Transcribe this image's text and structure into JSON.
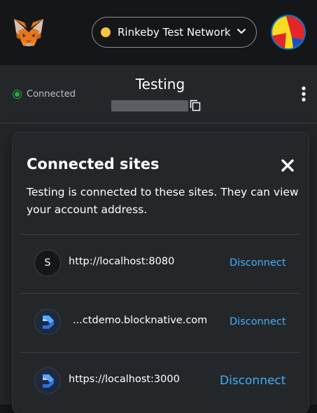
{
  "header": {
    "network": {
      "label": "Rinkeby Test Network",
      "dot_color": "#f6c343"
    }
  },
  "account": {
    "status": "Connected",
    "name": "Testing"
  },
  "modal": {
    "title": "Connected sites",
    "description": "Testing is connected to these sites. They can view your account address.",
    "disconnect_label": "Disconnect",
    "sites": [
      {
        "icon_letter": "S",
        "url": "http://localhost:8080",
        "icon": "letter"
      },
      {
        "url": "...ctdemo.blocknative.com",
        "icon": "blocknative-logo-icon"
      },
      {
        "url": "https://localhost:3000",
        "icon": "blocknative-logo-icon"
      }
    ]
  },
  "colors": {
    "accent_link": "#43aefc",
    "connected_green": "#28a745",
    "panel_bg": "#24272a",
    "topbar_bg": "#141618"
  }
}
